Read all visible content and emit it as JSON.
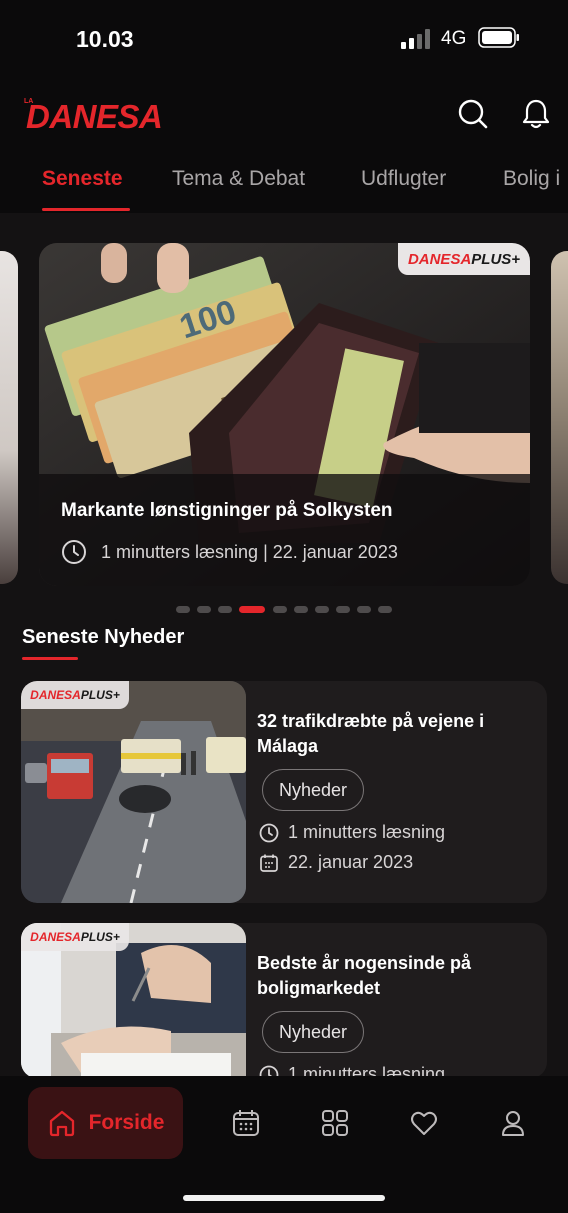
{
  "status_bar": {
    "time": "10.03",
    "network": "4G"
  },
  "header": {
    "logo_prefix": "LA",
    "logo_text": "DANESA"
  },
  "tabs": [
    {
      "label": "Seneste"
    },
    {
      "label": "Tema & Debat"
    },
    {
      "label": "Udflugter"
    },
    {
      "label": "Bolig i"
    }
  ],
  "carousel": {
    "badge_red": "DANESA",
    "badge_dark": "PLUS+",
    "title": "Markante lønstigninger på Solkysten",
    "meta": "1 minutters læsning | 22. januar 2023",
    "page_count": 11,
    "active_index": 3
  },
  "section": {
    "title": "Seneste Nyheder"
  },
  "news": [
    {
      "badge_red": "DANESA",
      "badge_dark": "PLUS+",
      "title": "32 trafikdræbte på vejene i Málaga",
      "tag": "Nyheder",
      "reading_time": "1 minutters læsning",
      "date": "22. januar 2023"
    },
    {
      "badge_red": "DANESA",
      "badge_dark": "PLUS+",
      "title": "Bedste år nogensinde på boligmarkedet",
      "tag": "Nyheder",
      "reading_time": "1 minutters læsning"
    }
  ],
  "bottom_nav": {
    "home_label": "Forside",
    "icons": [
      "home-icon",
      "calendar-icon",
      "grid-icon",
      "heart-icon",
      "profile-icon"
    ]
  },
  "colors": {
    "accent": "#e4262b",
    "background": "#0b0a0b",
    "card": "#1f1c1d"
  }
}
